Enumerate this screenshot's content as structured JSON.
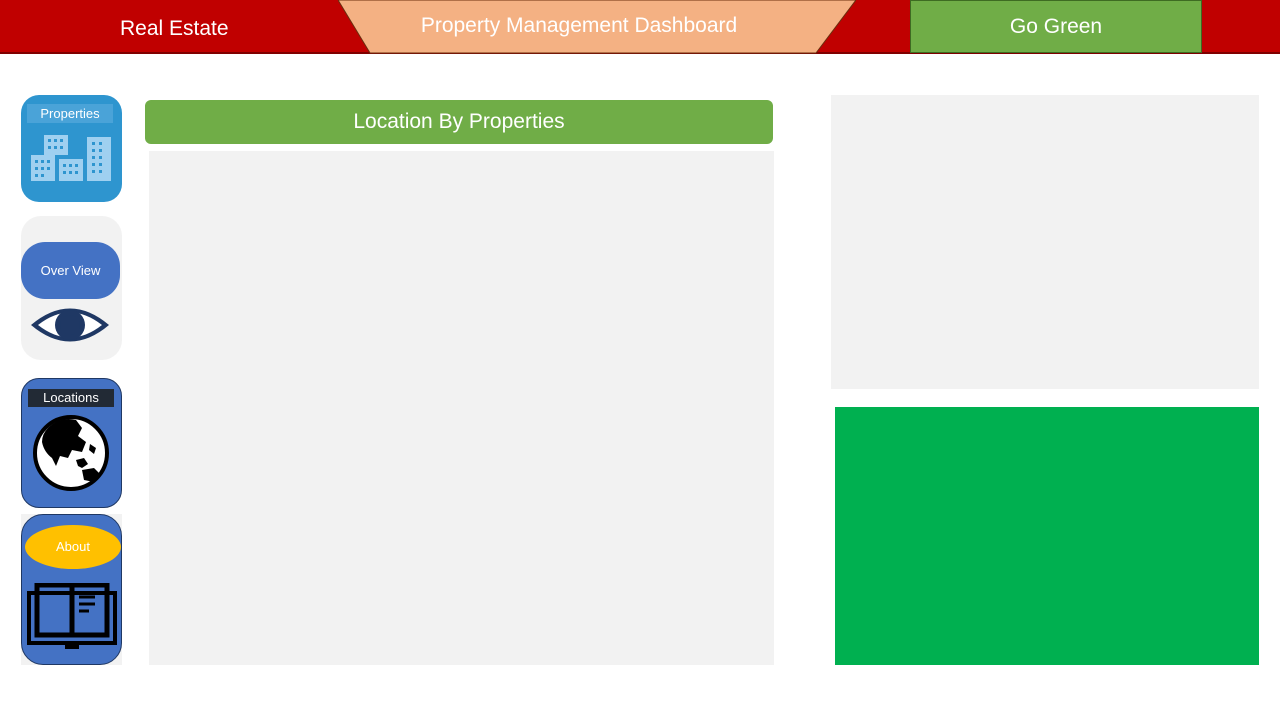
{
  "header": {
    "brand": "Real Estate",
    "title": "Property Management Dashboard",
    "go_green_button": "Go Green",
    "colors": {
      "bar": "#c00000",
      "title_tab": "#f4b183",
      "go_green": "#70ad47"
    }
  },
  "sidebar": {
    "items": [
      {
        "label": "Properties",
        "icon": "buildings-icon",
        "color": "#2e95cf"
      },
      {
        "label": "Over View",
        "icon": "eye-icon",
        "color": "#4472c4"
      },
      {
        "label": "Locations",
        "icon": "globe-icon",
        "color": "#4472c4"
      },
      {
        "label": "About",
        "icon": "book-icon",
        "color": "#ffc000"
      }
    ]
  },
  "main": {
    "panel_title": "Location By Properties",
    "colors": {
      "header": "#70ad47",
      "panel": "#f2f2f2"
    }
  },
  "right_panels": {
    "colors": {
      "top": "#f2f2f2",
      "bottom": "#00b050"
    }
  }
}
